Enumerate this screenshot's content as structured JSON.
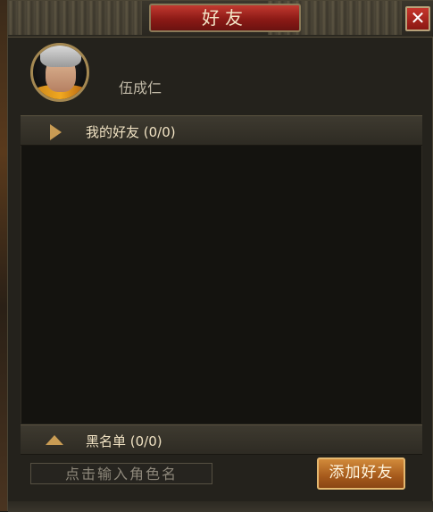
{
  "window": {
    "title": "好友",
    "close_glyph": "✕"
  },
  "profile": {
    "player_name": "伍成仁",
    "avatar_icon": "warrior-portrait-icon"
  },
  "sections": {
    "friends_label": "我的好友 (0/0)",
    "blacklist_label": "黑名单 (0/0)"
  },
  "search": {
    "placeholder": "点击输入角色名"
  },
  "actions": {
    "add_friend_label": "添加好友"
  },
  "colors": {
    "title_plate": "#8c1a16",
    "accent_gold": "#c99c54",
    "button_orange": "#a65a1c"
  }
}
